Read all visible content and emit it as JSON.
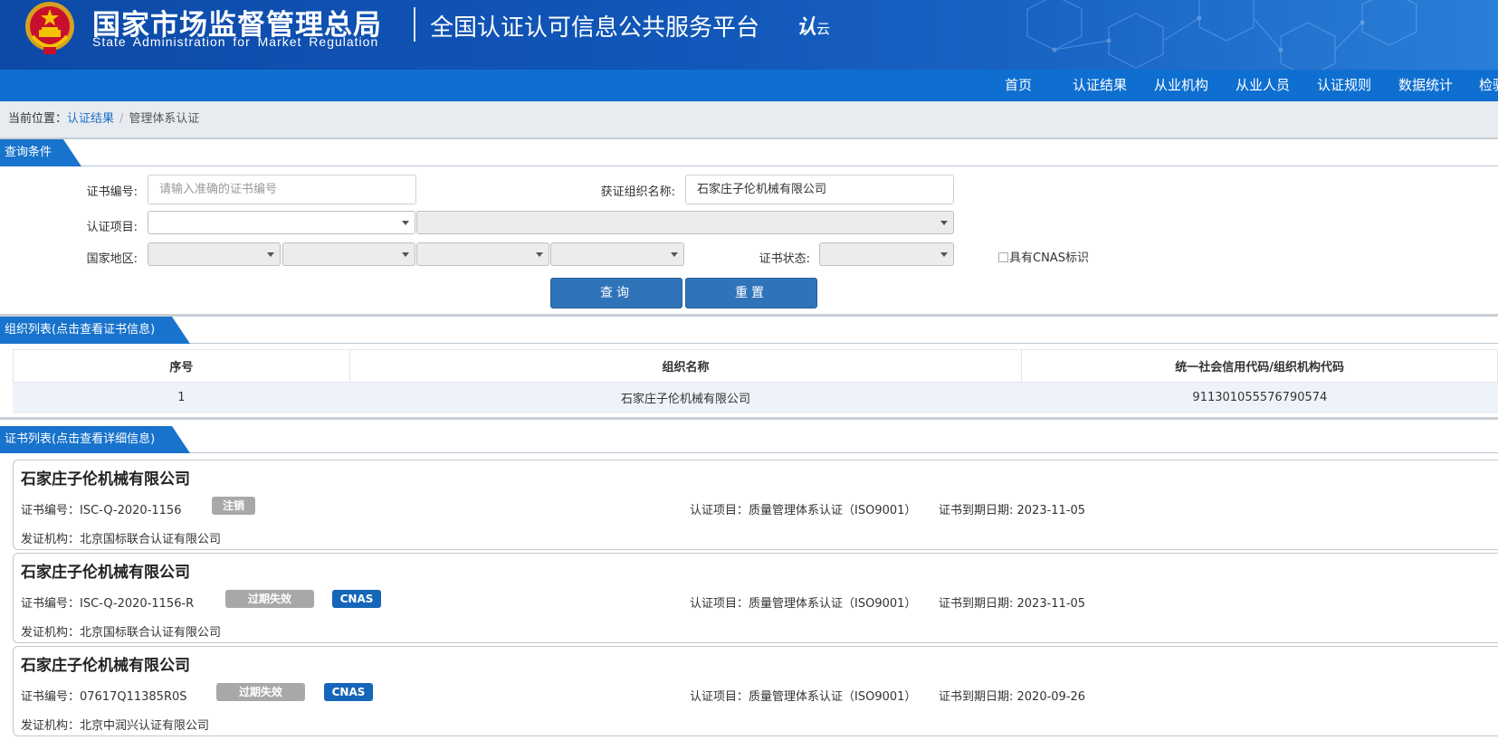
{
  "header": {
    "org_name_cn": "国家市场监督管理总局",
    "org_name_en": "State Administration  for  Market Regulation",
    "platform_name": "全国认证认可信息公共服务平台",
    "brand_mark": "认",
    "brand_mark_suffix": "云"
  },
  "nav": {
    "items": [
      "首页",
      "认证结果",
      "从业机构",
      "从业人员",
      "认证规则",
      "数据统计",
      "检验"
    ]
  },
  "breadcrumb": {
    "prefix": "当前位置：",
    "link": "认证结果",
    "separator": "/",
    "current": "管理体系认证"
  },
  "query": {
    "section_title": "查询条件",
    "cert_no_label": "证书编号:",
    "cert_no_placeholder": "请输入准确的证书编号",
    "cert_no_value": "",
    "org_name_label": "获证组织名称:",
    "org_name_value": "石家庄子伦机械有限公司",
    "cert_item_label": "认证项目:",
    "region_label": "国家地区:",
    "status_label": "证书状态:",
    "cnas_checkbox_label": "具有CNAS标识",
    "search_button": "查询",
    "reset_button": "重置"
  },
  "org_list": {
    "section_title": "组织列表(点击查看证书信息)",
    "columns": [
      "序号",
      "组织名称",
      "统一社会信用代码/组织机构代码"
    ],
    "rows": [
      {
        "index": "1",
        "name": "石家庄子伦机械有限公司",
        "code": "911301055576790574"
      }
    ]
  },
  "cert_list": {
    "section_title": "证书列表(点击查看详细信息)",
    "certs": [
      {
        "org_name": "石家庄子伦机械有限公司",
        "cert_no": "证书编号：ISC-Q-2020-1156",
        "status": "注销",
        "cnas": "",
        "project": "认证项目：质量管理体系认证（ISO9001）",
        "expiry": "证书到期日期: 2023-11-05",
        "issuer": "发证机构：北京国标联合认证有限公司"
      },
      {
        "org_name": "石家庄子伦机械有限公司",
        "cert_no": "证书编号：ISC-Q-2020-1156-R",
        "status": "过期失效",
        "cnas": "CNAS",
        "project": "认证项目：质量管理体系认证（ISO9001）",
        "expiry": "证书到期日期: 2023-11-05",
        "issuer": "发证机构：北京国标联合认证有限公司"
      },
      {
        "org_name": "石家庄子伦机械有限公司",
        "cert_no": "证书编号：07617Q11385R0S",
        "status": "过期失效",
        "cnas": "CNAS",
        "project": "认证项目：质量管理体系认证（ISO9001）",
        "expiry": "证书到期日期: 2020-09-26",
        "issuer": "发证机构：北京中润兴认证有限公司"
      }
    ]
  },
  "colors": {
    "header_blue": "#0d4aa8",
    "nav_blue": "#0f6fd0",
    "section_tab": "#1873cc",
    "button_blue": "#2f73b8",
    "badge_gray": "#a8a8a8",
    "badge_cnas": "#1565b8"
  }
}
